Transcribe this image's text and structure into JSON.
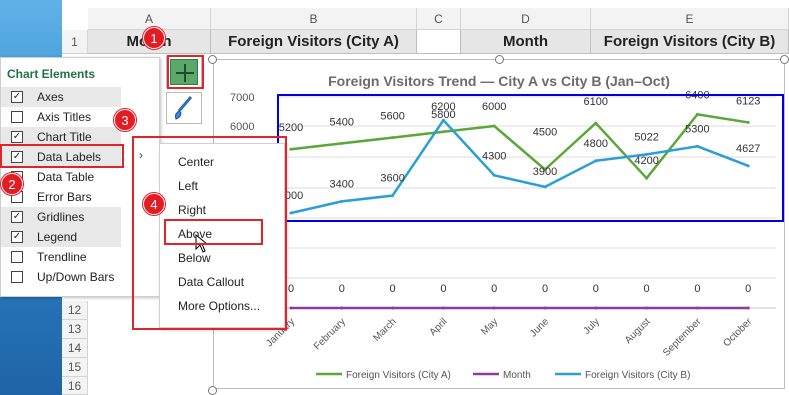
{
  "spreadsheet": {
    "columns": [
      "A",
      "B",
      "C",
      "D",
      "E"
    ],
    "rows": [
      "1",
      "12",
      "13",
      "14",
      "15",
      "16"
    ],
    "header_cells": [
      "Month",
      "Foreign Visitors (City A)",
      "",
      "Month",
      "Foreign Visitors (City B)"
    ]
  },
  "chart": {
    "title": "Foreign Visitors Trend — City A vs City B (Jan–Oct)"
  },
  "chart_data": {
    "type": "line",
    "title": "Foreign Visitors Trend — City A vs City B (Jan–Oct)",
    "categories": [
      "January",
      "February",
      "March",
      "April",
      "May",
      "June",
      "July",
      "August",
      "September",
      "October"
    ],
    "y_ticks": [
      "7000",
      "6000"
    ],
    "series": [
      {
        "name": "Foreign Visitors (City A)",
        "color": "#5aa83a",
        "values": [
          5200,
          5400,
          5600,
          5800,
          6000,
          4500,
          6100,
          4200,
          6400,
          6123
        ],
        "labels": [
          "5200",
          "5400",
          "5600",
          "5800",
          "6000",
          "4500",
          "6100",
          "4200",
          "6400",
          "6123"
        ]
      },
      {
        "name": "Month",
        "color": "#8e3a9e",
        "values": [
          0,
          0,
          0,
          0,
          0,
          0,
          0,
          0,
          0,
          0
        ],
        "labels": [
          "0",
          "0",
          "0",
          "0",
          "0",
          "0",
          "0",
          "0",
          "0",
          "0"
        ]
      },
      {
        "name": "Foreign Visitors (City B)",
        "color": "#2a9fd6",
        "values": [
          3000,
          3400,
          3600,
          6200,
          4300,
          3900,
          4800,
          5022,
          5300,
          4627
        ],
        "labels": [
          "3000",
          "3400",
          "3600",
          "6200",
          "4300",
          "3900",
          "4800",
          "5022",
          "5300",
          "4627"
        ]
      }
    ],
    "legend": "bottom"
  },
  "chart_elements_panel": {
    "title": "Chart Elements",
    "items": [
      {
        "label": "Axes",
        "checked": true
      },
      {
        "label": "Axis Titles",
        "checked": false
      },
      {
        "label": "Chart Title",
        "checked": true
      },
      {
        "label": "Data Labels",
        "checked": true
      },
      {
        "label": "Data Table",
        "checked": false
      },
      {
        "label": "Error Bars",
        "checked": false
      },
      {
        "label": "Gridlines",
        "checked": true
      },
      {
        "label": "Legend",
        "checked": true
      },
      {
        "label": "Trendline",
        "checked": false
      },
      {
        "label": "Up/Down Bars",
        "checked": false
      }
    ]
  },
  "data_labels_submenu": {
    "items": [
      "Center",
      "Left",
      "Right",
      "Above",
      "Below",
      "Data Callout",
      "More Options..."
    ]
  },
  "step_badges": [
    "1",
    "2",
    "3",
    "4"
  ],
  "colors": {
    "annotation_red": "#e0242b",
    "selection_blue": "#0000e0",
    "excel_green": "#217346"
  }
}
